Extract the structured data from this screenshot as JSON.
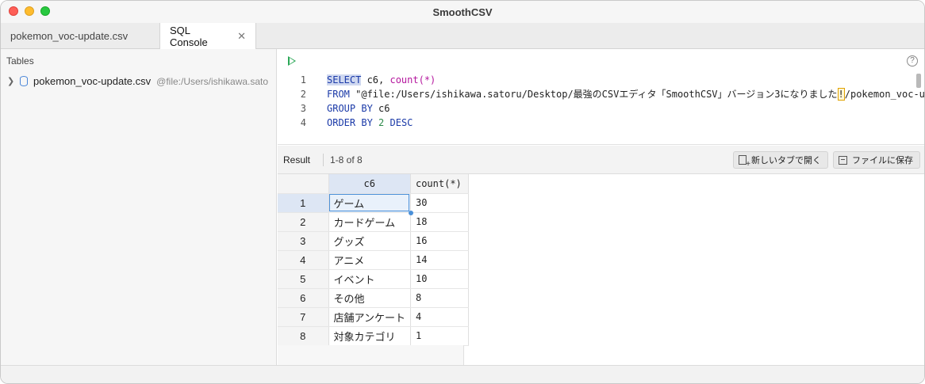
{
  "app": {
    "title": "SmoothCSV"
  },
  "tabs": [
    {
      "label": "pokemon_voc-update.csv",
      "active": false
    },
    {
      "label": "SQL Console",
      "active": true
    }
  ],
  "sidebar": {
    "title": "Tables",
    "table": {
      "name": "pokemon_voc-update.csv",
      "path": "@file:/Users/ishikawa.sato"
    }
  },
  "editor": {
    "lines": [
      {
        "num": "1",
        "kw1": "SELECT",
        "t1": " c6, ",
        "fn": "count",
        "t2": "(*)"
      },
      {
        "num": "2",
        "kw": "FROM",
        "t1": " \"@file:/Users/ishikawa.satoru/Desktop/最強のCSVエディタ「SmoothCSV」バージョン3になりました",
        "mark": "!",
        "t2": "/pokemon_voc-u"
      },
      {
        "num": "3",
        "kw": "GROUP BY",
        "t1": " c6"
      },
      {
        "num": "4",
        "kw": "ORDER BY",
        "numval": "2",
        "kw2": "DESC"
      }
    ]
  },
  "result": {
    "label": "Result",
    "count": "1-8 of 8",
    "open_new_tab": "新しいタブで開く",
    "save_to_file": "ファイルに保存",
    "columns": [
      "c6",
      "count(*)"
    ],
    "rows": [
      {
        "n": "1",
        "c6": "ゲーム",
        "count": "30"
      },
      {
        "n": "2",
        "c6": "カードゲーム",
        "count": "18"
      },
      {
        "n": "3",
        "c6": "グッズ",
        "count": "16"
      },
      {
        "n": "4",
        "c6": "アニメ",
        "count": "14"
      },
      {
        "n": "5",
        "c6": "イベント",
        "count": "10"
      },
      {
        "n": "6",
        "c6": "その他",
        "count": "8"
      },
      {
        "n": "7",
        "c6": "店舗アンケート",
        "count": "4"
      },
      {
        "n": "8",
        "c6": "対象カテゴリ",
        "count": "1"
      }
    ]
  }
}
